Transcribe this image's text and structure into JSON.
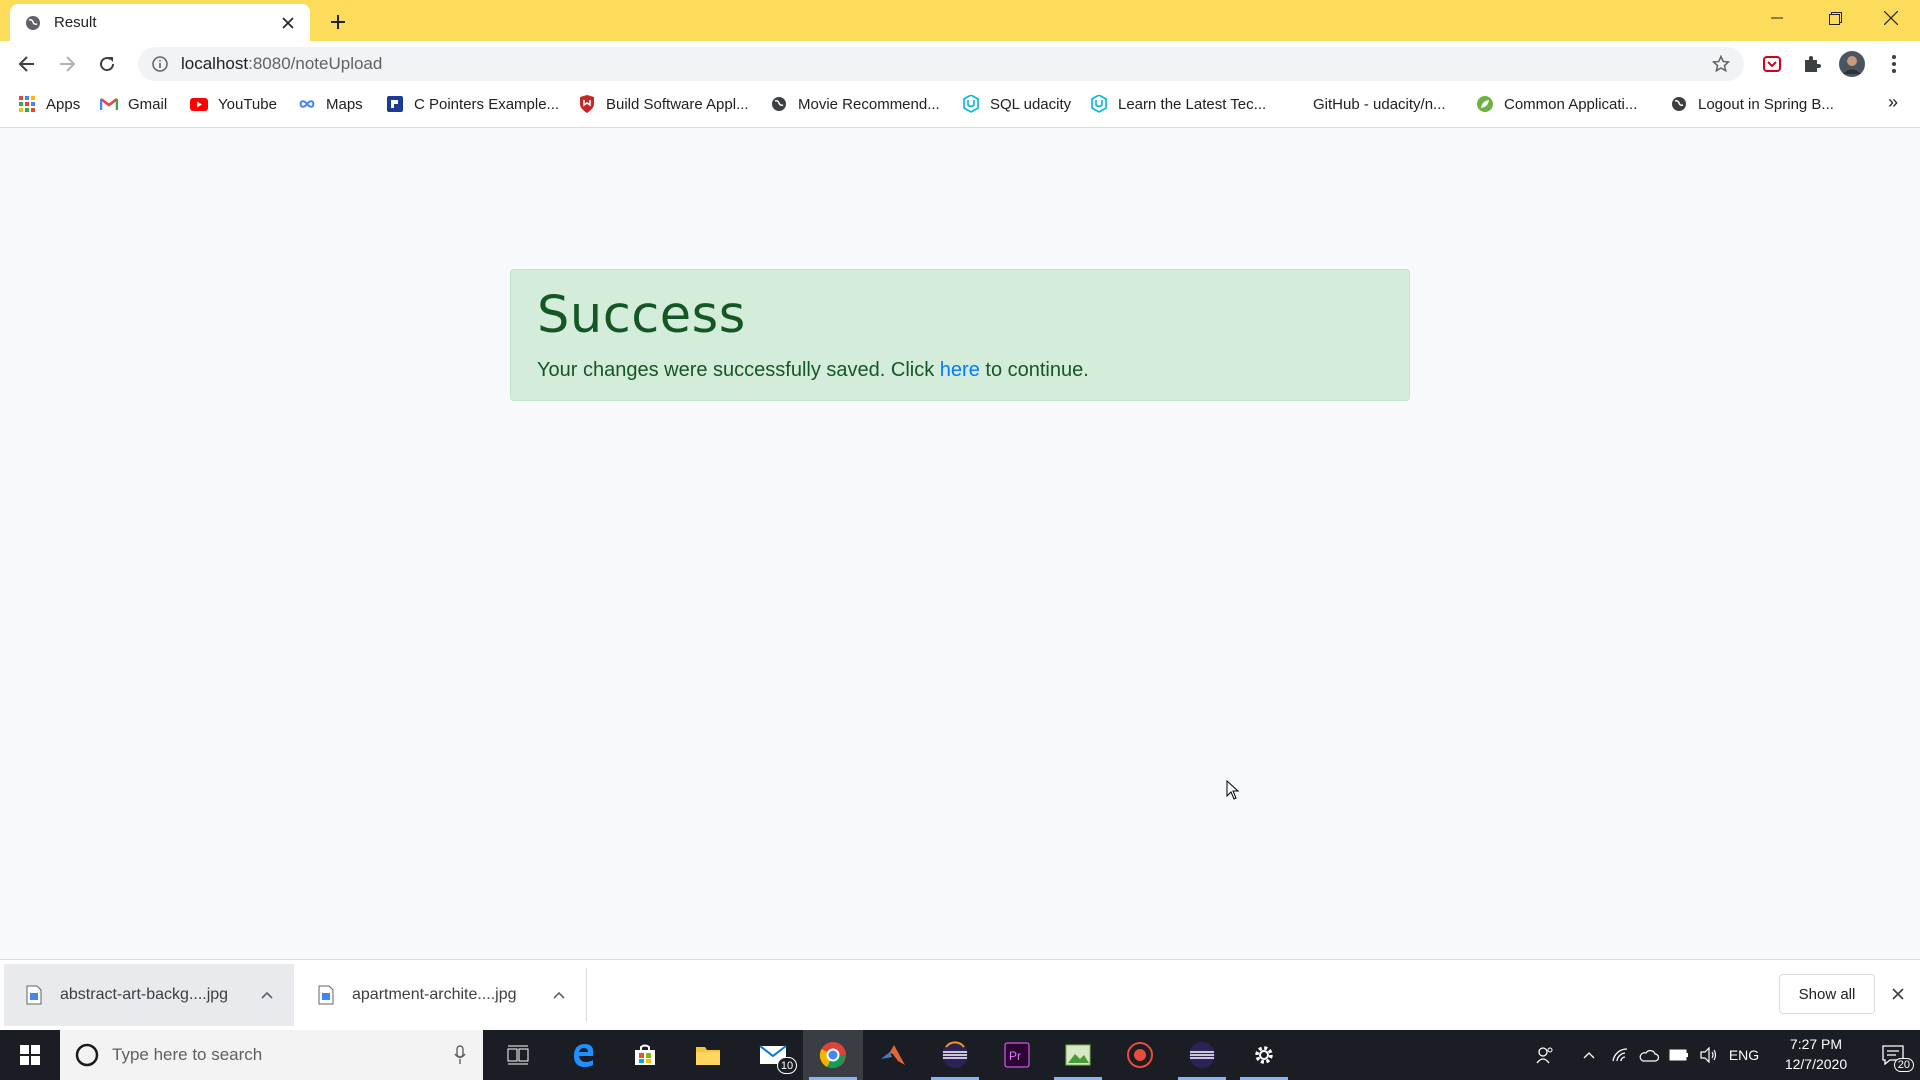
{
  "browser": {
    "tab": {
      "title": "Result",
      "favicon": "globe-icon"
    },
    "url": {
      "host": "localhost",
      "path": ":8080/noteUpload"
    },
    "bookmarks": [
      {
        "label": "Apps",
        "icon": "apps-grid-icon"
      },
      {
        "label": "Gmail",
        "icon": "gmail-icon"
      },
      {
        "label": "YouTube",
        "icon": "youtube-icon"
      },
      {
        "label": "Maps",
        "icon": "maps-icon"
      },
      {
        "label": "C Pointers Example...",
        "icon": "bookmark-site-icon"
      },
      {
        "label": "Build Software Appl...",
        "icon": "shield-icon"
      },
      {
        "label": "Movie Recommend...",
        "icon": "globe-icon"
      },
      {
        "label": "SQL udacity",
        "icon": "udacity-icon"
      },
      {
        "label": "Learn the Latest Tec...",
        "icon": "udacity-icon"
      },
      {
        "label": "GitHub - udacity/n...",
        "icon": "none"
      },
      {
        "label": "Common Applicati...",
        "icon": "leaf-icon"
      },
      {
        "label": "Logout in Spring B...",
        "icon": "globe-icon"
      }
    ],
    "more_bookmarks": "»"
  },
  "page": {
    "alert": {
      "heading": "Success",
      "text_before": "Your changes were successfully saved. Click ",
      "link": "here",
      "text_after": " to continue."
    }
  },
  "downloads": {
    "items": [
      {
        "name": "abstract-art-backg....jpg"
      },
      {
        "name": "apartment-archite....jpg"
      }
    ],
    "show_all": "Show all"
  },
  "taskbar": {
    "search_placeholder": "Type here to search",
    "mail_badge": "10",
    "language": "ENG",
    "time": "7:27 PM",
    "date": "12/7/2020",
    "notifications": "20"
  },
  "colors": {
    "titlebar": "#fddc5c",
    "alert_bg": "#d4edda",
    "alert_text": "#155724",
    "link": "#007bff",
    "taskbar": "#1a1d23"
  }
}
